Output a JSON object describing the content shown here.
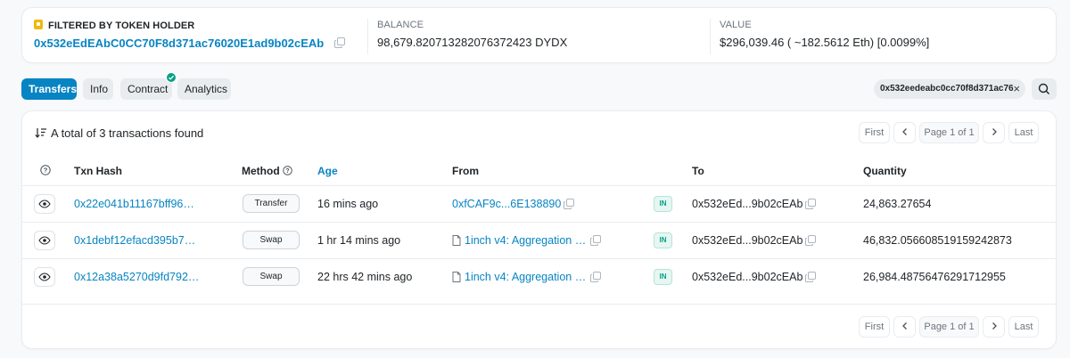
{
  "summary": {
    "holder_label": "FILTERED BY TOKEN HOLDER",
    "holder_address": "0x532eEdEAbC0CC70F8d371ac76020E1ad9b02cEAb",
    "balance_label": "BALANCE",
    "balance_value": "98,679.820713282076372423 DYDX",
    "value_label": "VALUE",
    "value_value": "$296,039.46 ( ~182.5612 Eth) [0.0099%]"
  },
  "tabs": [
    {
      "label": "Transfers",
      "active": true
    },
    {
      "label": "Info"
    },
    {
      "label": "Contract",
      "verified": true
    },
    {
      "label": "Analytics"
    }
  ],
  "filter": {
    "value": "0x532eedeabc0cc70f8d371ac76",
    "close": "×"
  },
  "table": {
    "total_text": "A total of 3 transactions found",
    "pager": {
      "first": "First",
      "page": "Page 1 of 1",
      "last": "Last"
    },
    "headers": {
      "hash": "Txn Hash",
      "method": "Method",
      "age": "Age",
      "from": "From",
      "to": "To",
      "quantity": "Quantity"
    },
    "rows": [
      {
        "hash": "0x22e041b11167bff96…",
        "method": "Transfer",
        "age": "16 mins ago",
        "from": "0xfCAF9c...6E138890",
        "from_is_contract": false,
        "direction": "IN",
        "to": "0x532eEd...9b02cEAb",
        "quantity": "24,863.27654"
      },
      {
        "hash": "0x1debf12efacd395b7…",
        "method": "Swap",
        "age": "1 hr 14 mins ago",
        "from": "1inch v4: Aggregation …",
        "from_is_contract": true,
        "direction": "IN",
        "to": "0x532eEd...9b02cEAb",
        "quantity": "46,832.056608519159242873"
      },
      {
        "hash": "0x12a38a5270d9fd792…",
        "method": "Swap",
        "age": "22 hrs 42 mins ago",
        "from": "1inch v4: Aggregation …",
        "from_is_contract": true,
        "direction": "IN",
        "to": "0x532eEd...9b02cEAb",
        "quantity": "26,984.48756476291712955"
      }
    ]
  },
  "colors": {
    "accent": "#0784c3",
    "success": "#00a186",
    "muted": "#6c757d"
  }
}
